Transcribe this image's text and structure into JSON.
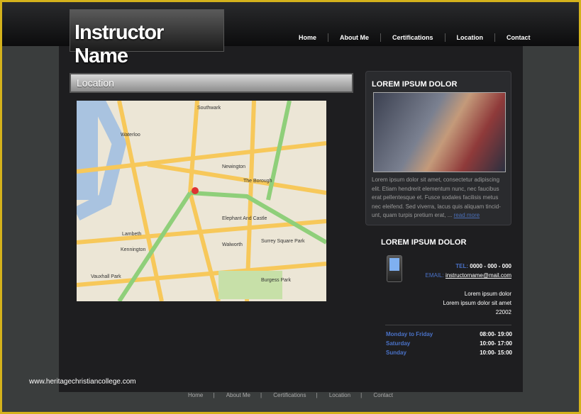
{
  "header": {
    "logo": "Instructor Name",
    "nav": [
      "Home",
      "About Me",
      "Certifications",
      "Location",
      "Contact"
    ]
  },
  "location": {
    "title": "Location",
    "map_labels": [
      "Waterloo",
      "Lambeth",
      "Kennington",
      "Newington",
      "The Borough",
      "Elephant And Castle",
      "Walworth",
      "Southwark",
      "Surrey Square Park",
      "Burgess Park",
      "Vauxhall Park"
    ]
  },
  "sidebar": {
    "title": "LOREM IPSUM DOLOR",
    "text": "Lorem ipsum dolor sit amet, consectetur adipiscing elit. Etiam hendrerit elementum nunc, nec faucibus erat pellentesque et. Fusce sodales facilisis metus nec eleifend. Sed viverra, lacus quis aliquam tincid-unt, quam turpis pretium erat, ...",
    "read_more": "read more"
  },
  "contact": {
    "title": "LOREM IPSUM DOLOR",
    "tel_label": "TEL:",
    "tel": "0000 - 000 - 000",
    "email_label": "EMAIL:",
    "email": "instructorname@mail.com",
    "address": [
      "Lorem ipsum dolor",
      "Lorem ipsum dolor  sit amet",
      "22002"
    ],
    "hours": [
      {
        "day": "Monday to Friday",
        "time": "08:00- 19:00"
      },
      {
        "day": "Saturday",
        "time": "10:00- 17:00"
      },
      {
        "day": "Sunday",
        "time": "10:00- 15:00"
      }
    ]
  },
  "footer": [
    "Home",
    "About Me",
    "Certifications",
    "Location",
    "Contact"
  ],
  "watermark": "www.heritagechristiancollege.com",
  "colors": {
    "accent": "#4a72c8",
    "background": "#1e1e20"
  }
}
